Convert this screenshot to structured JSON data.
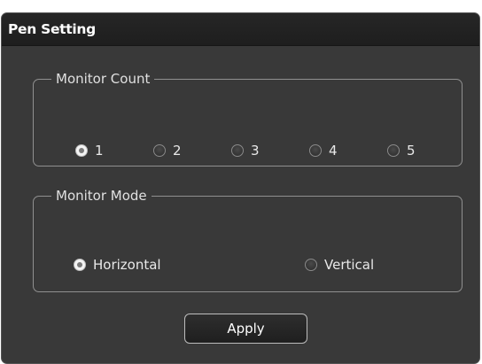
{
  "window": {
    "title": "Pen Setting"
  },
  "monitor_count": {
    "legend": "Monitor Count",
    "options": [
      "1",
      "2",
      "3",
      "4",
      "5"
    ],
    "selected": "1"
  },
  "monitor_mode": {
    "legend": "Monitor Mode",
    "options": [
      "Horizontal",
      "Vertical"
    ],
    "selected": "Horizontal"
  },
  "apply_label": "Apply",
  "colors": {
    "window_bg": "#393939",
    "titlebar_bg": "#1f1f1f",
    "text": "#e8e8e8",
    "group_border": "#909090"
  }
}
